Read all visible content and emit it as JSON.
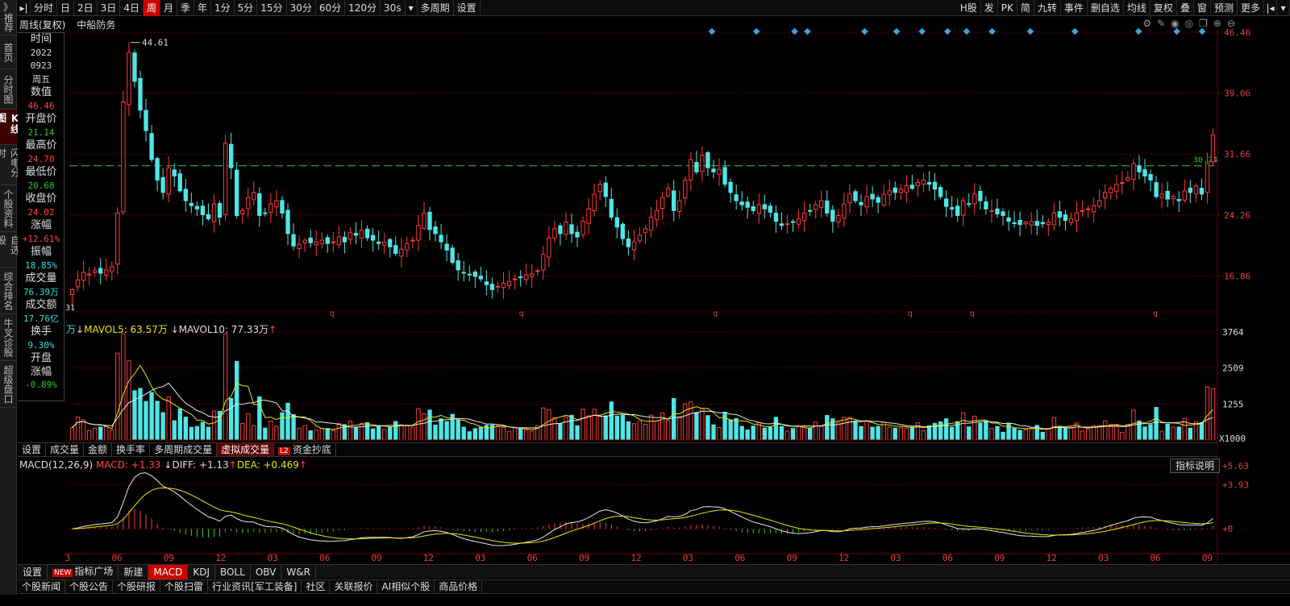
{
  "left_nav": {
    "top": [
      "》",
      "推荐"
    ],
    "items": [
      {
        "label": "首页",
        "active": false
      },
      {
        "label": "分时图",
        "active": false
      },
      {
        "label": "K线图",
        "active": true
      },
      {
        "label": "闪电分时",
        "active": false
      },
      {
        "label": "个股资料",
        "active": false
      },
      {
        "label": "自选股",
        "active": false
      },
      {
        "label": "综合排名",
        "active": false
      },
      {
        "label": "牛叉诊股",
        "active": false
      },
      {
        "label": "超级盘口",
        "active": false
      }
    ]
  },
  "toolbar": {
    "periods": [
      {
        "label": "分时",
        "active": false
      },
      {
        "label": "日",
        "active": false
      },
      {
        "label": "2日",
        "active": false
      },
      {
        "label": "3日",
        "active": false
      },
      {
        "label": "4日",
        "active": false
      },
      {
        "label": "周",
        "active": true
      },
      {
        "label": "月",
        "active": false
      },
      {
        "label": "季",
        "active": false
      },
      {
        "label": "年",
        "active": false
      },
      {
        "label": "1分",
        "active": false
      },
      {
        "label": "5分",
        "active": false
      },
      {
        "label": "15分",
        "active": false
      },
      {
        "label": "30分",
        "active": false
      },
      {
        "label": "60分",
        "active": false
      },
      {
        "label": "120分",
        "active": false
      },
      {
        "label": "30s",
        "active": false
      }
    ],
    "multi_period": "多周期",
    "settings": "设置",
    "right_buttons": [
      "H股",
      "发",
      "PK",
      "简",
      "九转",
      "事件",
      "删自选",
      "均线",
      "复权",
      "叠",
      "窗",
      "预测",
      "更多"
    ]
  },
  "title": {
    "mode": "周线(复权)",
    "stock_name": "中船防务"
  },
  "info_panel": [
    {
      "label": "时间",
      "values": [
        "2022",
        "0923",
        "周五"
      ],
      "color": "white"
    },
    {
      "label": "数值",
      "values": [
        "46.46"
      ],
      "color": "red"
    },
    {
      "label": "开盘价",
      "values": [
        "21.14"
      ],
      "color": "green"
    },
    {
      "label": "最高价",
      "values": [
        "24.70"
      ],
      "color": "red"
    },
    {
      "label": "最低价",
      "values": [
        "20.68"
      ],
      "color": "green"
    },
    {
      "label": "收盘价",
      "values": [
        "24.02"
      ],
      "color": "red"
    },
    {
      "label": "涨幅",
      "values": [
        "+12.61%"
      ],
      "color": "red"
    },
    {
      "label": "振幅",
      "values": [
        "18.85%"
      ],
      "color": "cyan"
    },
    {
      "label": "成交量",
      "values": [
        "76.39万"
      ],
      "color": "cyan"
    },
    {
      "label": "成交额",
      "values": [
        "17.76亿"
      ],
      "color": "cyan"
    },
    {
      "label": "换手",
      "values": [
        "9.30%"
      ],
      "color": "cyan"
    },
    {
      "label": "开盘涨幅",
      "values": [
        "-0.89%"
      ],
      "color": "green"
    }
  ],
  "price_axis": {
    "labels": [
      "46.46",
      "39.06",
      "31.66",
      "24.26",
      "16.86"
    ],
    "high_marker": "44.61",
    "low_marker": "31",
    "hline_value": "30.24"
  },
  "volume": {
    "unit_prefix": "万",
    "mavol5_label": "MAVOL5: 63.57万",
    "mavol10_label": "MAVOL10: 77.33万",
    "axis_labels": [
      "3764",
      "2509",
      "1255"
    ],
    "axis_unit": "X1000"
  },
  "volume_tabs": [
    {
      "label": "设置",
      "active": false
    },
    {
      "label": "成交量",
      "active": false
    },
    {
      "label": "金额",
      "active": false
    },
    {
      "label": "换手率",
      "active": false
    },
    {
      "label": "多周期成交量",
      "active": false
    },
    {
      "label": "虚拟成交量",
      "active": true
    },
    {
      "label": "资金抄底",
      "active": false,
      "badge": "L2"
    }
  ],
  "macd": {
    "name": "MACD(12,26,9)",
    "macd_label": "MACD: +1.33",
    "diff_label": "DIFF: +1.13",
    "dea_label": "DEA: +0.469",
    "axis_labels": [
      "+5.63",
      "+3.93",
      "+0"
    ],
    "help": "指标说明"
  },
  "x_axis": [
    "03",
    "06",
    "09",
    "12",
    "03",
    "06",
    "09",
    "12",
    "03",
    "06",
    "09",
    "12",
    "03",
    "06",
    "09",
    "12",
    "03",
    "06",
    "09",
    "12",
    "03",
    "06",
    "09"
  ],
  "indicator_tabs": [
    {
      "label": "设置",
      "active": false
    },
    {
      "label": "指标广场",
      "active": false,
      "badge": "NEW"
    },
    {
      "label": "新建",
      "active": false
    },
    {
      "label": "MACD",
      "active": true
    },
    {
      "label": "KDJ",
      "active": false
    },
    {
      "label": "BOLL",
      "active": false
    },
    {
      "label": "OBV",
      "active": false
    },
    {
      "label": "W&R",
      "active": false
    }
  ],
  "news_tabs": [
    "个股新闻",
    "个股公告",
    "个股研报",
    "个股扫雷",
    "行业资讯[军工装备]",
    "社区",
    "关联报价",
    "AI相似个股",
    "商品价格"
  ],
  "colors": {
    "up": "#ff3b3b",
    "down": "#4ee6e6",
    "ma_white": "#e8e8e8",
    "ma_yellow": "#e6e600",
    "grid": "#7a0000",
    "hline": "#2ec82e",
    "diamond": "#3aa6dc"
  },
  "chart_data": {
    "type": "candlestick",
    "price_range": [
      12.5,
      46.46
    ],
    "closes": [
      15.2,
      16.4,
      17.3,
      17.1,
      17.5,
      17.2,
      17.6,
      18.0,
      24.5,
      38.0,
      44.0,
      40.5,
      37.0,
      34.5,
      31.0,
      28.5,
      27.0,
      30.0,
      29.0,
      27.2,
      26.0,
      25.4,
      25.0,
      24.3,
      23.8,
      25.6,
      24.0,
      33.0,
      30.0,
      24.2,
      24.8,
      26.4,
      27.0,
      24.2,
      24.5,
      25.6,
      26.0,
      24.5,
      22.0,
      20.5,
      20.7,
      21.2,
      20.9,
      21.0,
      21.2,
      20.8,
      21.0,
      21.6,
      21.0,
      22.1,
      21.8,
      22.4,
      21.5,
      21.2,
      20.8,
      21.0,
      20.4,
      19.6,
      20.1,
      20.8,
      21.2,
      23.0,
      24.5,
      22.5,
      22.0,
      21.0,
      20.0,
      18.5,
      17.6,
      17.2,
      17.0,
      16.8,
      16.5,
      15.8,
      15.2,
      15.6,
      16.0,
      16.2,
      16.5,
      16.7,
      17.0,
      17.1,
      17.5,
      19.5,
      21.5,
      22.6,
      22.0,
      23.4,
      22.0,
      21.6,
      23.5,
      25.0,
      26.8,
      28.0,
      26.5,
      24.0,
      22.8,
      21.4,
      20.4,
      21.0,
      21.8,
      22.6,
      24.0,
      24.8,
      26.4,
      27.5,
      24.8,
      26.0,
      28.5,
      31.0,
      29.5,
      31.5,
      30.0,
      29.5,
      29.8,
      28.0,
      27.0,
      26.0,
      25.5,
      25.2,
      24.8,
      25.5,
      25.0,
      24.6,
      23.5,
      23.0,
      23.2,
      23.4,
      23.8,
      24.5,
      24.8,
      25.5,
      26.0,
      24.5,
      23.5,
      24.2,
      25.6,
      26.8,
      26.0,
      25.5,
      26.5,
      26.2,
      25.8,
      26.8,
      27.2,
      27.0,
      27.4,
      27.8,
      27.5,
      28.2,
      28.5,
      28.0,
      27.4,
      26.5,
      25.3,
      25.0,
      24.2,
      26.0,
      25.6,
      26.8,
      26.0,
      25.0,
      24.8,
      24.4,
      24.2,
      23.5,
      23.3,
      23.1,
      23.4,
      23.5,
      23.0,
      23.2,
      23.4,
      24.5,
      24.0,
      23.6,
      23.8,
      24.5,
      24.8,
      25.0,
      25.4,
      26.0,
      27.0,
      27.5,
      28.0,
      28.2,
      28.8,
      30.5,
      29.5,
      29.0,
      28.5,
      26.5,
      26.8,
      26.2,
      26.5,
      26.0,
      27.2,
      27.0,
      27.8,
      26.8,
      30.5,
      34.0
    ],
    "volume_scale": [
      0,
      3764
    ],
    "macd_scale": [
      -2.0,
      5.63
    ]
  }
}
